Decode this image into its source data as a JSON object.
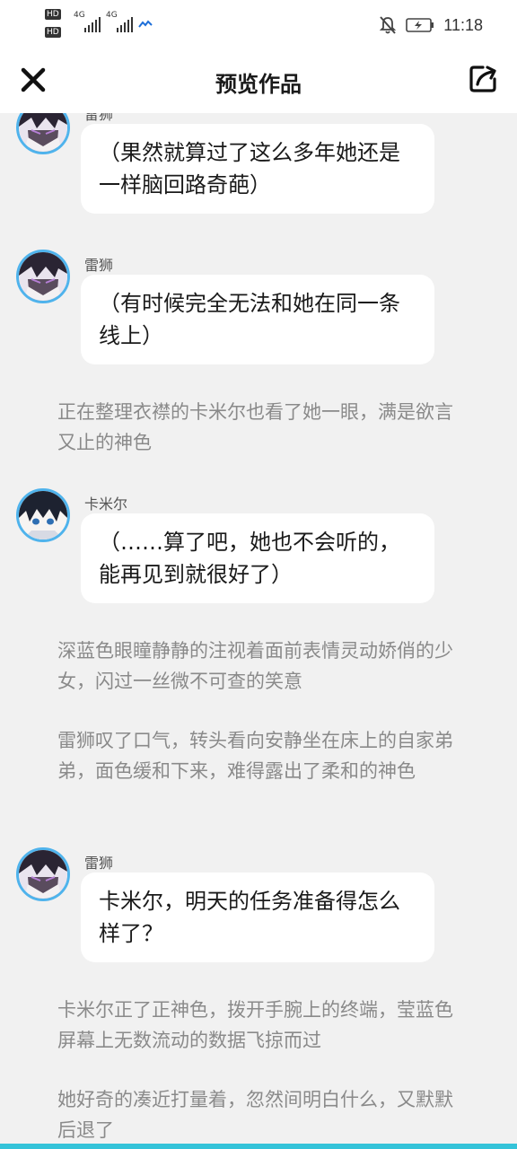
{
  "status_bar": {
    "hd_labels": [
      "HD",
      "HD"
    ],
    "network_labels": [
      "4G",
      "4G"
    ],
    "time": "11:18"
  },
  "header": {
    "title": "预览作品",
    "close_icon": "close-icon",
    "share_icon": "share-icon"
  },
  "colors": {
    "accent": "#4fb3ec",
    "bottom_bar": "#34c3d9",
    "narration": "#8a8a8a",
    "background": "#f1f1f1"
  },
  "story": [
    {
      "kind": "dialogue",
      "speaker": "雷狮",
      "avatar": "leishi-avatar",
      "text": "（果然就算过了这么多年她还是一样脑回路奇葩）"
    },
    {
      "kind": "dialogue",
      "speaker": "雷狮",
      "avatar": "leishi-avatar",
      "text": "（有时候完全无法和她在同一条线上）"
    },
    {
      "kind": "narration",
      "text": "正在整理衣襟的卡米尔也看了她一眼，满是欲言又止的神色"
    },
    {
      "kind": "dialogue",
      "speaker": "卡米尔",
      "avatar": "kamier-avatar",
      "text": "（……算了吧，她也不会听的，能再见到就很好了）"
    },
    {
      "kind": "narration",
      "text": "深蓝色眼瞳静静的注视着面前表情灵动娇俏的少女，闪过一丝微不可查的笑意"
    },
    {
      "kind": "narration",
      "text": "雷狮叹了口气，转头看向安静坐在床上的自家弟弟，面色缓和下来，难得露出了柔和的神色"
    },
    {
      "kind": "dialogue",
      "speaker": "雷狮",
      "avatar": "leishi-avatar",
      "text": "卡米尔，明天的任务准备得怎么样了？"
    },
    {
      "kind": "narration",
      "text": "卡米尔正了正神色，拨开手腕上的终端，莹蓝色屏幕上无数流动的数据飞掠而过"
    },
    {
      "kind": "narration",
      "text": "她好奇的凑近打量着，忽然间明白什么，又默默后退了"
    }
  ]
}
